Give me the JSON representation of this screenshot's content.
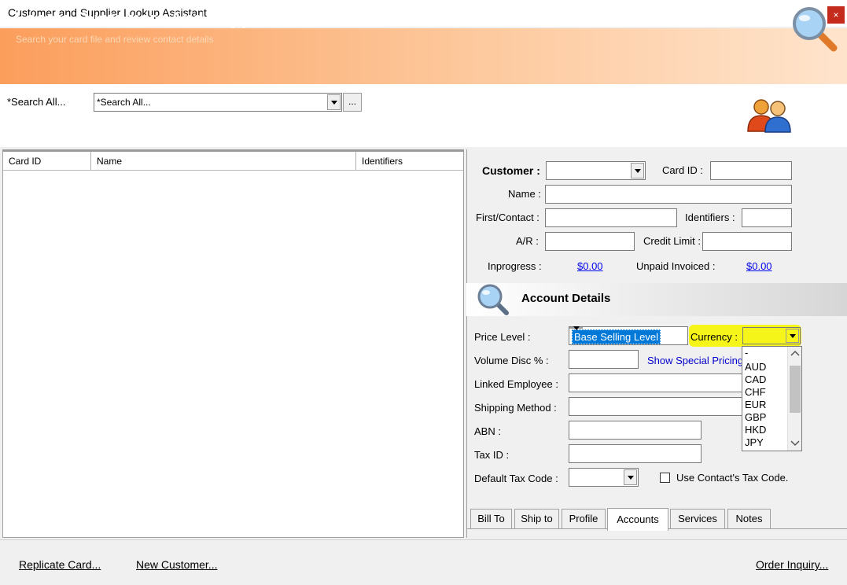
{
  "window": {
    "title": "Customer and Supplier Lookup Assistant",
    "close_label": "×"
  },
  "banner": {
    "title": "Locate Customers And Suppliers",
    "subtitle": "Search your card file and review contact details",
    "icon": "magnifier-icon"
  },
  "search": {
    "label": "*Search All...",
    "value": "*Search All...",
    "ellipsis_label": "...",
    "icon": "people-icon"
  },
  "grid": {
    "columns": [
      "Card ID",
      "Name",
      "Identifiers"
    ],
    "rows": []
  },
  "detail": {
    "customer_label": "Customer :",
    "card_id_label": "Card ID :",
    "name_label": "Name :",
    "first_contact_label": "First/Contact :",
    "identifiers_label": "Identifiers :",
    "ar_label": "A/R :",
    "credit_limit_label": "Credit Limit :",
    "inprogress_label": "Inprogress :",
    "inprogress_value": "$0.00",
    "unpaid_label": "Unpaid Invoiced :",
    "unpaid_value": "$0.00"
  },
  "account": {
    "title": "Account Details",
    "price_level_label": "Price Level :",
    "price_level_value": "Base Selling Level",
    "currency_label": "Currency :",
    "currency_options": [
      "-",
      "AUD",
      "CAD",
      "CHF",
      "EUR",
      "GBP",
      "HKD",
      "JPY"
    ],
    "volume_disc_label": "Volume Disc % :",
    "special_pricing_link": "Show Special Pricing",
    "linked_employee_label": "Linked Employee :",
    "shipping_method_label": "Shipping Method :",
    "abn_label": "ABN :",
    "tax_id_label": "Tax ID :",
    "default_tax_label": "Default Tax Code :",
    "use_contact_tax_label": "Use Contact's Tax Code."
  },
  "tabs": [
    "Bill To",
    "Ship to",
    "Profile",
    "Accounts",
    "Services",
    "Notes"
  ],
  "active_tab": "Accounts",
  "footer": {
    "replicate": "Replicate Card...",
    "new_customer": "New Customer...",
    "order_inquiry": "Order Inquiry..."
  },
  "colors": {
    "banner_orange": "#fb9e5c",
    "highlight_yellow": "#f5f51a",
    "link_blue": "#0000ee",
    "selection_blue": "#0078d7"
  }
}
